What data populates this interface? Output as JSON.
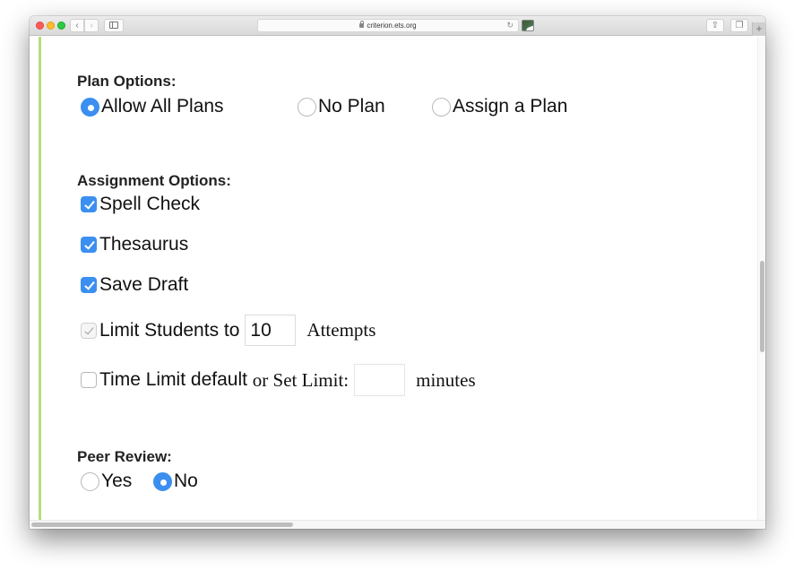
{
  "browser": {
    "url": "criterion.ets.org",
    "back_glyph": "‹",
    "forward_glyph": "›",
    "reload_glyph": "↻",
    "new_tab_glyph": "+",
    "share_glyph": "⇧",
    "tabs_glyph": "❐"
  },
  "colors": {
    "accent_bar": "#b6dd7b",
    "control_blue": "#3b8ff0"
  },
  "plan_options": {
    "title": "Plan Options:",
    "options": [
      {
        "label": "Allow All Plans",
        "selected": true
      },
      {
        "label": "No Plan",
        "selected": false
      },
      {
        "label": "Assign a Plan",
        "selected": false
      }
    ]
  },
  "assignment_options": {
    "title": "Assignment Options:",
    "spell_check": {
      "label": "Spell Check",
      "checked": true
    },
    "thesaurus": {
      "label": "Thesaurus",
      "checked": true
    },
    "save_draft": {
      "label": "Save Draft",
      "checked": true
    },
    "limit_students": {
      "label": "Limit Students to",
      "checked": true,
      "disabled": true,
      "value": "10",
      "suffix": "Attempts"
    },
    "time_limit": {
      "label_sans": "Time Limit default",
      "label_serif": "or Set Limit:",
      "checked": false,
      "value": "",
      "suffix": "minutes"
    }
  },
  "peer_review": {
    "title": "Peer Review:",
    "options": [
      {
        "label": "Yes",
        "selected": false
      },
      {
        "label": "No",
        "selected": true
      }
    ]
  }
}
